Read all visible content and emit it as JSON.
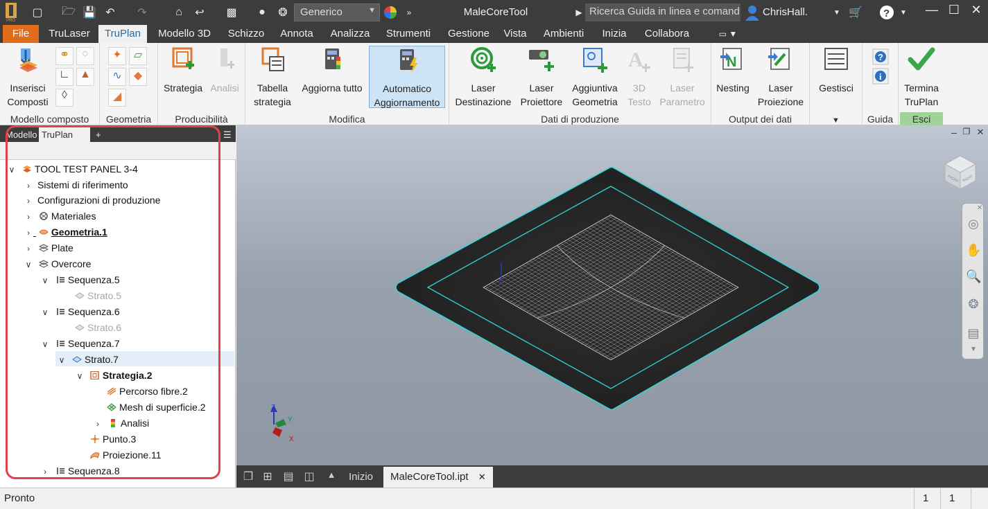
{
  "titlebar": {
    "style_combo": "Generico",
    "app_title": "MaleCoreTool",
    "search_placeholder": "Ricerca Guida in linea e comand",
    "user": "ChrisHall."
  },
  "tabs": [
    "File",
    "TruLaser",
    "TruPlan",
    "Modello 3D",
    "Schizzo",
    "Annota",
    "Analizza",
    "Strumenti",
    "Gestione",
    "Vista",
    "Ambienti",
    "Inizia",
    "Collabora"
  ],
  "ribbon": {
    "panels": {
      "modello_composto": "Modello composto",
      "geometria": "Geometria",
      "producibilita": "Producibilità",
      "modifica": "Modifica",
      "dati_produzione": "Dati di produzione",
      "output_dati": "Output dei dati",
      "guida": "Guida",
      "esci": "Esci"
    },
    "buttons": {
      "inserisci": [
        "Inserisci",
        "Composti"
      ],
      "strategia": [
        "Strategia"
      ],
      "analisi": [
        "Analisi"
      ],
      "tabella": [
        "Tabella",
        "strategia"
      ],
      "aggiorna": [
        "Aggiorna tutto"
      ],
      "automatico": [
        "Automatico",
        "Aggiornamento"
      ],
      "laser_dest": [
        "Laser",
        "Destinazione"
      ],
      "laser_proi": [
        "Laser",
        "Proiettore"
      ],
      "aggiuntiva": [
        "Aggiuntiva",
        "Geometria"
      ],
      "testo3d": [
        "3D",
        "Testo"
      ],
      "laser_param": [
        "Laser",
        "Parametro"
      ],
      "nesting": [
        "Nesting"
      ],
      "laser_proiezione": [
        "Laser",
        "Proiezione"
      ],
      "gestisci": [
        "Gestisci"
      ],
      "termina": [
        "Termina",
        "TruPlan"
      ]
    }
  },
  "browser": {
    "tabs": [
      "Modello",
      "TruPlan"
    ],
    "tree": [
      {
        "label": "TOOL TEST PANEL 3-4"
      },
      {
        "label": "Sistemi di riferimento"
      },
      {
        "label": "Configurazioni di produzione"
      },
      {
        "label": "Materiales"
      },
      {
        "label": "Geometria.1"
      },
      {
        "label": "Plate"
      },
      {
        "label": "Overcore"
      },
      {
        "label": "Sequenza.5"
      },
      {
        "label": "Strato.5"
      },
      {
        "label": "Sequenza.6"
      },
      {
        "label": "Strato.6"
      },
      {
        "label": "Sequenza.7"
      },
      {
        "label": "Strato.7"
      },
      {
        "label": "Strategia.2"
      },
      {
        "label": "Percorso fibre.2"
      },
      {
        "label": "Mesh di superficie.2"
      },
      {
        "label": "Analisi"
      },
      {
        "label": "Punto.3"
      },
      {
        "label": "Proiezione.11"
      },
      {
        "label": "Sequenza.8"
      }
    ]
  },
  "viewport": {
    "viewcube_labels": [
      "FRONT",
      "RIGHT"
    ],
    "axis_labels": [
      "Z",
      "Y",
      "X"
    ],
    "colors": {
      "outline": "#2ed7d7",
      "surface": "#2b2b2b",
      "mesh": "#d9d9d9"
    }
  },
  "doctabs": [
    "Inizio",
    "MaleCoreTool.ipt"
  ],
  "status": {
    "text": "Pronto",
    "cell1": "1",
    "cell2": "1"
  }
}
